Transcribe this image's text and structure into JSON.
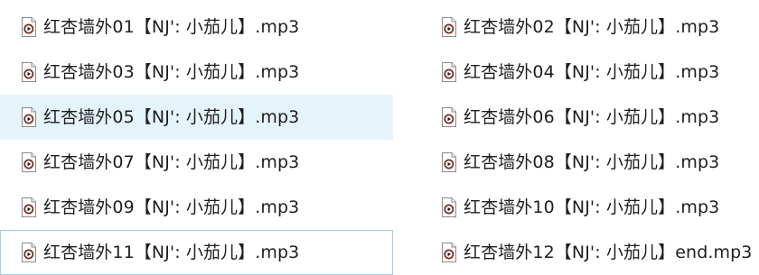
{
  "files": [
    {
      "name": "红杏墙外01【NJ': 小茄儿】.mp3",
      "icon": "audio-file-icon"
    },
    {
      "name": "红杏墙外02【NJ': 小茄儿】.mp3",
      "icon": "audio-file-icon"
    },
    {
      "name": "红杏墙外03【NJ': 小茄儿】.mp3",
      "icon": "audio-file-icon"
    },
    {
      "name": "红杏墙外04【NJ': 小茄儿】.mp3",
      "icon": "audio-file-icon"
    },
    {
      "name": "红杏墙外05【NJ': 小茄儿】.mp3",
      "icon": "audio-file-icon"
    },
    {
      "name": "红杏墙外06【NJ': 小茄儿】.mp3",
      "icon": "audio-file-icon"
    },
    {
      "name": "红杏墙外07【NJ': 小茄儿】.mp3",
      "icon": "audio-file-icon"
    },
    {
      "name": "红杏墙外08【NJ': 小茄儿】.mp3",
      "icon": "audio-file-icon"
    },
    {
      "name": "红杏墙外09【NJ': 小茄儿】.mp3",
      "icon": "audio-file-icon"
    },
    {
      "name": "红杏墙外10【NJ': 小茄儿】.mp3",
      "icon": "audio-file-icon"
    },
    {
      "name": "红杏墙外11【NJ': 小茄儿】.mp3",
      "icon": "audio-file-icon"
    },
    {
      "name": "红杏墙外12【NJ': 小茄儿】end.mp3",
      "icon": "audio-file-icon"
    }
  ],
  "colors": {
    "hover_background": "#e5f3fb",
    "focus_border": "#99d1ef",
    "icon_ring": "#7a2a1a",
    "icon_play": "#1a1a1a",
    "text": "#1e1e1e"
  }
}
